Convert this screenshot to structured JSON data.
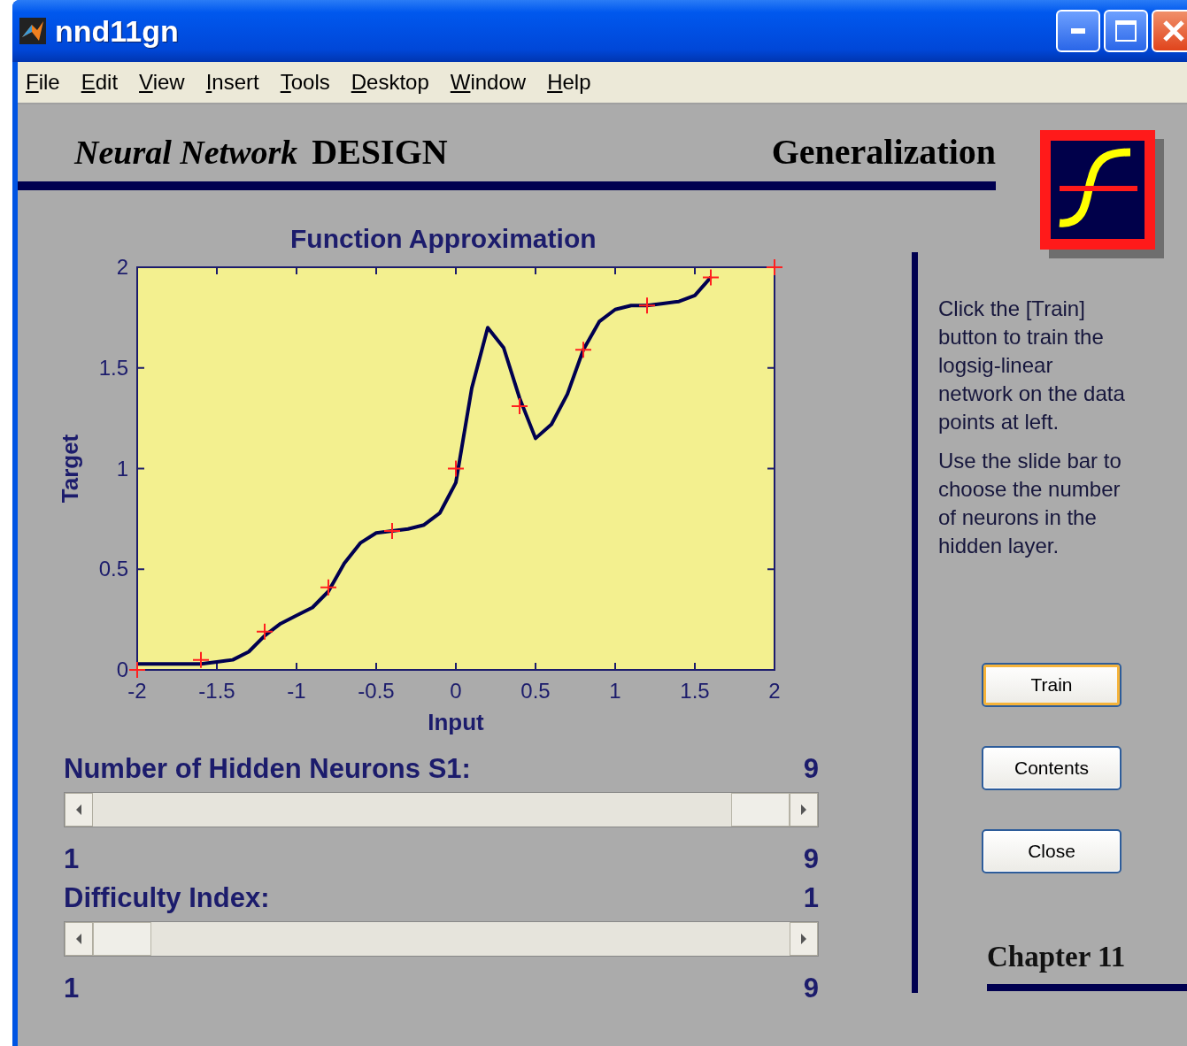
{
  "window": {
    "title": "nnd11gn"
  },
  "menu": [
    "File",
    "Edit",
    "View",
    "Insert",
    "Tools",
    "Desktop",
    "Window",
    "Help"
  ],
  "header": {
    "brand_italic": "Neural Network",
    "brand_bold": "DESIGN",
    "topic": "Generalization"
  },
  "plot": {
    "title": "Function Approximation",
    "chart_data": {
      "type": "line",
      "xlabel": "Input",
      "ylabel": "Target",
      "xlim": [
        -2,
        2
      ],
      "ylim": [
        0,
        2
      ],
      "xticks": [
        -2,
        -1.5,
        -1,
        -0.5,
        0,
        0.5,
        1,
        1.5,
        2
      ],
      "yticks": [
        0,
        0.5,
        1,
        1.5,
        2
      ],
      "x": [
        -2,
        -1.9,
        -1.8,
        -1.7,
        -1.6,
        -1.5,
        -1.4,
        -1.3,
        -1.2,
        -1.1,
        -1,
        -0.9,
        -0.8,
        -0.7,
        -0.6,
        -0.5,
        -0.4,
        -0.3,
        -0.2,
        -0.1,
        0,
        0.1,
        0.2,
        0.3,
        0.4,
        0.5,
        0.6,
        0.7,
        0.8,
        0.9,
        1,
        1.1,
        1.2,
        1.3,
        1.4,
        1.5,
        1.6,
        1.7,
        1.8,
        1.9,
        2
      ],
      "series": [
        {
          "color": "#000050",
          "values": [
            0.03,
            0.03,
            0.03,
            0.03,
            0.03,
            0.04,
            0.05,
            0.09,
            0.17,
            0.23,
            0.27,
            0.31,
            0.39,
            0.53,
            0.63,
            0.68,
            0.69,
            0.7,
            0.72,
            0.78,
            0.93,
            1.4,
            1.7,
            1.6,
            1.35,
            1.15,
            1.22,
            1.37,
            1.59,
            1.73,
            1.79,
            1.81,
            1.81,
            1.82,
            1.83,
            1.86,
            1.95,
            null,
            null,
            null,
            null
          ]
        },
        {
          "color": "#ff2020",
          "marker": "+",
          "values": [
            0,
            null,
            null,
            null,
            0.05,
            null,
            null,
            null,
            0.19,
            null,
            null,
            null,
            0.41,
            null,
            null,
            null,
            0.69,
            null,
            null,
            null,
            1,
            null,
            null,
            null,
            1.31,
            null,
            null,
            null,
            1.59,
            null,
            null,
            null,
            1.81,
            null,
            null,
            null,
            1.95,
            null,
            null,
            null,
            2
          ]
        }
      ]
    }
  },
  "sliders": [
    {
      "label": "Number of Hidden Neurons S1:",
      "value": "9",
      "min": "1",
      "max": "9",
      "level": 1
    },
    {
      "label": "Difficulty Index:",
      "value": "1",
      "min": "1",
      "max": "9",
      "level": 0
    }
  ],
  "instructions": [
    "Click the [Train] button to train the logsig-linear network on the data points at left.",
    "Use the slide bar to choose the number of neurons in the hidden layer."
  ],
  "buttons": [
    {
      "label": "Train",
      "focused": true
    },
    {
      "label": "Contents",
      "focused": false
    },
    {
      "label": "Close",
      "focused": false
    }
  ],
  "chapter": "Chapter 11"
}
